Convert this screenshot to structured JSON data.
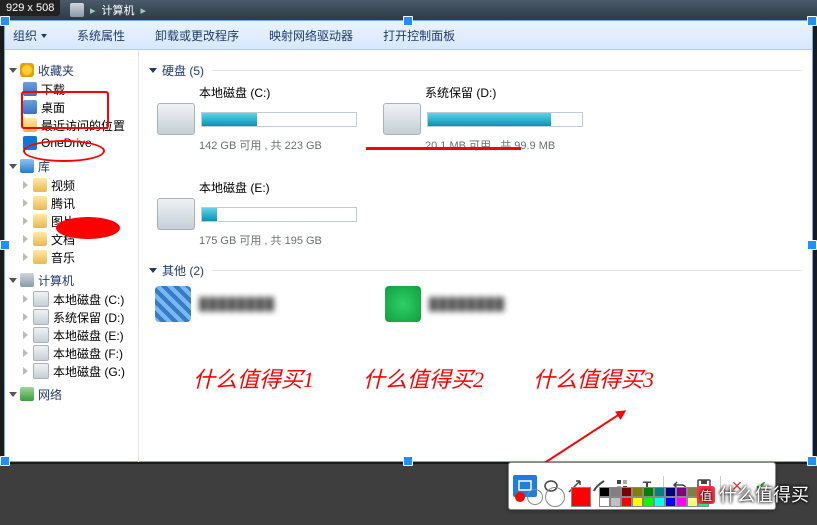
{
  "dim_tag": "929 x 508",
  "breadcrumb": {
    "arrow": "▸",
    "label": "计算机",
    "arrow2": "▸"
  },
  "toolbar": {
    "organize": "组织",
    "sysprops": "系统属性",
    "uninstall": "卸载或更改程序",
    "mapdrive": "映射网络驱动器",
    "controlpanel": "打开控制面板"
  },
  "sidebar": {
    "favorites": {
      "label": "收藏夹",
      "items": [
        {
          "label": "下载"
        },
        {
          "label": "桌面"
        },
        {
          "label": "最近访问的位置"
        },
        {
          "label": "OneDrive"
        }
      ]
    },
    "libraries": {
      "label": "库",
      "items": [
        {
          "label": "视频"
        },
        {
          "label": "腾讯"
        },
        {
          "label": "图片"
        },
        {
          "label": "文档"
        },
        {
          "label": "音乐"
        }
      ]
    },
    "computer": {
      "label": "计算机",
      "items": [
        {
          "label": "本地磁盘 (C:)"
        },
        {
          "label": "系统保留 (D:)"
        },
        {
          "label": "本地磁盘 (E:)"
        },
        {
          "label": "本地磁盘 (F:)"
        },
        {
          "label": "本地磁盘 (G:)"
        }
      ]
    },
    "network": {
      "label": "网络"
    }
  },
  "sections": {
    "drives_header": "硬盘 (5)",
    "others_header": "其他 (2)"
  },
  "drives": [
    {
      "name": "本地磁盘 (C:)",
      "stat": "142 GB 可用 , 共 223 GB",
      "fill": 36
    },
    {
      "name": "系统保留 (D:)",
      "stat": "20.1 MB 可用 , 共 99.9 MB",
      "fill": 80
    },
    {
      "name": "本地磁盘 (E:)",
      "stat": "175 GB 可用 , 共 195 GB",
      "fill": 10
    }
  ],
  "others": [
    {
      "text": "████████"
    },
    {
      "text": "████████"
    }
  ],
  "annotations": {
    "t1": "什么值得买1",
    "t2": "什么值得买2",
    "t3": "什么值得买3"
  },
  "editbar_swatches": [
    "#000000",
    "#808080",
    "#800000",
    "#808000",
    "#008000",
    "#008080",
    "#000080",
    "#800080",
    "#7f7f3f",
    "#003f3f",
    "#ffffff",
    "#c0c0c0",
    "#ff0000",
    "#ffff00",
    "#00ff00",
    "#00ffff",
    "#0000ff",
    "#ff00ff",
    "#ffff80",
    "#00ff80"
  ],
  "watermark": "什么值得买"
}
